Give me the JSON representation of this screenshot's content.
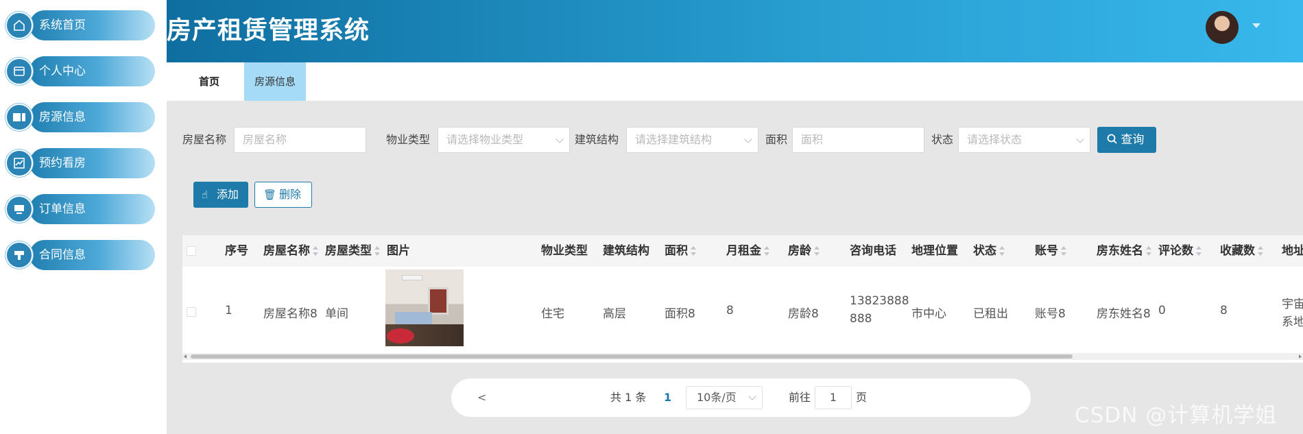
{
  "app": {
    "title": "房产租赁管理系统"
  },
  "sidebar": {
    "items": [
      {
        "label": "系统首页",
        "icon": "home-icon"
      },
      {
        "label": "个人中心",
        "icon": "card-icon"
      },
      {
        "label": "房源信息",
        "icon": "ticket-icon"
      },
      {
        "label": "预约看房",
        "icon": "chart-icon"
      },
      {
        "label": "订单信息",
        "icon": "monitor-icon"
      },
      {
        "label": "合同信息",
        "icon": "stamp-icon"
      }
    ]
  },
  "tabs": [
    {
      "label": "首页"
    },
    {
      "label": "房源信息",
      "active": true
    }
  ],
  "search": {
    "name_label": "房屋名称",
    "name_placeholder": "房屋名称",
    "property_type_label": "物业类型",
    "property_type_placeholder": "请选择物业类型",
    "structure_label": "建筑结构",
    "structure_placeholder": "请选择建筑结构",
    "area_label": "面积",
    "area_placeholder": "面积",
    "status_label": "状态",
    "status_placeholder": "请选择状态",
    "query_button": "查询"
  },
  "actions": {
    "add_button": "添加",
    "delete_button": "删除"
  },
  "table": {
    "columns": [
      "序号",
      "房屋名称",
      "房屋类型",
      "图片",
      "物业类型",
      "建筑结构",
      "面积",
      "月租金",
      "房龄",
      "咨询电话",
      "地理位置",
      "状态",
      "账号",
      "房东姓名",
      "评论数",
      "收藏数",
      "地址"
    ],
    "rows": [
      {
        "index": "1",
        "name": "房屋名称8",
        "type": "单间",
        "property_type": "住宅",
        "structure": "高层",
        "area": "面积8",
        "rent": "8",
        "age": "房龄8",
        "phone_line1": "13823888",
        "phone_line2": "888",
        "location": "市中心",
        "status": "已租出",
        "account": "账号8",
        "landlord": "房东姓名8",
        "comments": "0",
        "favorites": "8",
        "address_line1": "宇宙",
        "address_line2": "系地"
      }
    ]
  },
  "pagination": {
    "prev": "<",
    "total": "共 1 条",
    "current_page": "1",
    "page_size": "10条/页",
    "goto_label": "前往",
    "goto_value": "1",
    "page_suffix": "页"
  },
  "watermark": "CSDN @计算机学姐",
  "colors": {
    "primary": "#1e7aa8",
    "header_start": "#0f6ea0",
    "header_end": "#38b8ec",
    "tab_active": "#a5dbf6"
  }
}
